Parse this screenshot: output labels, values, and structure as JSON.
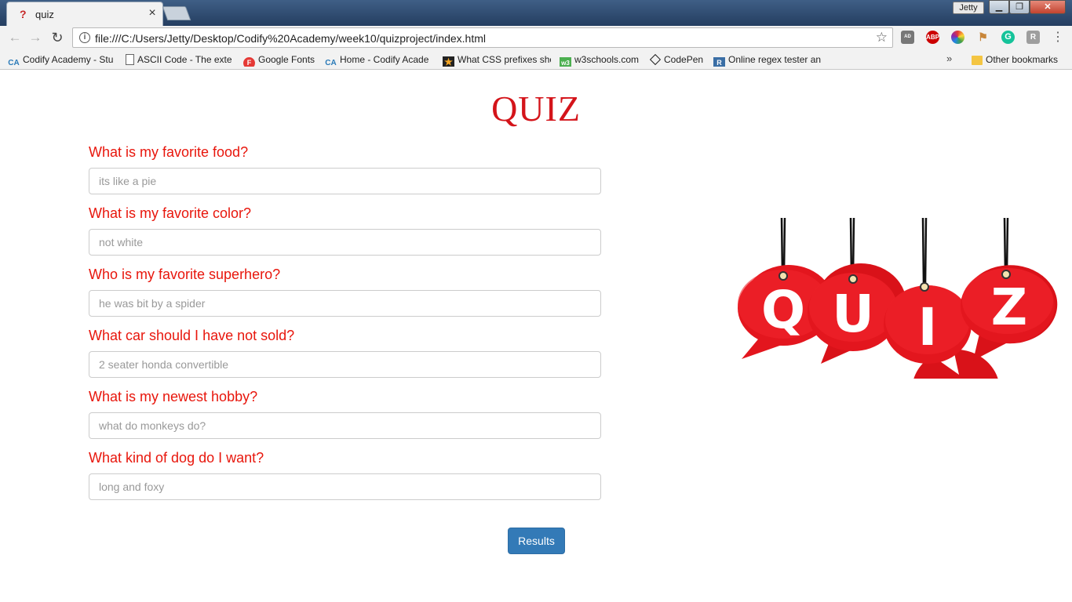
{
  "browser": {
    "tab_title": "quiz",
    "tab_close": "×",
    "profile_name": "Jetty",
    "url": "file:///C:/Users/Jetty/Desktop/Codify%20Academy/week10/quizproject/index.html",
    "bookmarks": [
      {
        "label": "Codify Academy - Stu",
        "icon": "codify-icon"
      },
      {
        "label": "ASCII Code - The exte",
        "icon": "document-icon"
      },
      {
        "label": "Google Fonts",
        "icon": "google-fonts-icon"
      },
      {
        "label": "Home - Codify Acade",
        "icon": "codify-icon"
      },
      {
        "label": "What CSS prefixes sho",
        "icon": "star-icon"
      },
      {
        "label": "w3schools.com",
        "icon": "w3schools-icon"
      },
      {
        "label": "CodePen",
        "icon": "codepen-icon"
      },
      {
        "label": "Online regex tester an",
        "icon": "regex-icon"
      }
    ],
    "more_bookmarks": "»",
    "other_bookmarks": "Other bookmarks"
  },
  "page": {
    "heading": "QUIZ",
    "questions": [
      {
        "label": "What is my favorite food?",
        "placeholder": "its like a pie"
      },
      {
        "label": "What is my favorite color?",
        "placeholder": "not white"
      },
      {
        "label": "Who is my favorite superhero?",
        "placeholder": "he was bit by a spider"
      },
      {
        "label": "What car should I have not sold?",
        "placeholder": "2 seater honda convertible"
      },
      {
        "label": "What is my newest hobby?",
        "placeholder": "what do monkeys do?"
      },
      {
        "label": "What kind of dog do I want?",
        "placeholder": "long and foxy"
      }
    ],
    "results_button": "Results",
    "quiz_image_letters": [
      "Q",
      "U",
      "I",
      "Z"
    ]
  },
  "colors": {
    "question_text": "#e8160c",
    "heading": "#d4141a",
    "button": "#337ab7"
  }
}
